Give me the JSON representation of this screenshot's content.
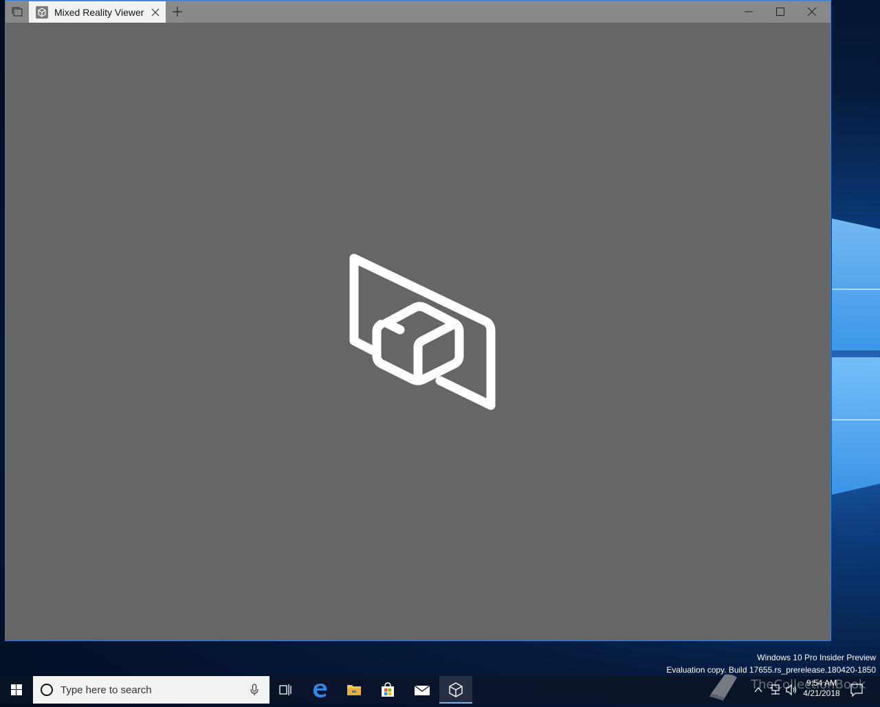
{
  "window": {
    "tab_title": "Mixed Reality Viewer"
  },
  "desktop": {
    "watermark_line1": "Windows 10 Pro Insider Preview",
    "watermark_line2": "Evaluation copy. Build 17655.rs_prerelease.180420-1850"
  },
  "taskbar": {
    "search_placeholder": "Type here to search",
    "clock_time": "9:54 AM",
    "clock_date": "4/21/2018",
    "overlay_text": "TheCollectionBook"
  },
  "colors": {
    "window_bg": "#666666",
    "titlebar": "#898989",
    "tab_bg": "#f2f2f2",
    "accent": "#2f7fd6"
  }
}
